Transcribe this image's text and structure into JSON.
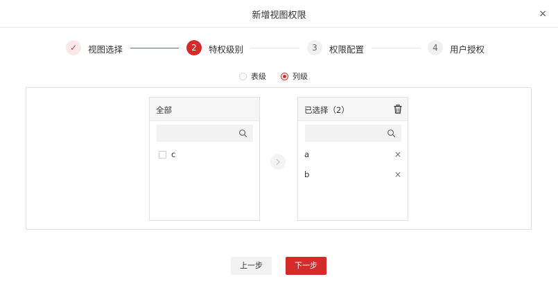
{
  "dialog": {
    "title": "新增视图权限",
    "close_glyph": "×"
  },
  "steps": [
    {
      "number": "✓",
      "label": "视图选择",
      "status": "done"
    },
    {
      "number": "2",
      "label": "特权级别",
      "status": "active"
    },
    {
      "number": "3",
      "label": "权限配置",
      "status": "pending"
    },
    {
      "number": "4",
      "label": "用户授权",
      "status": "pending"
    }
  ],
  "level_options": [
    {
      "label": "表级",
      "selected": false
    },
    {
      "label": "列级",
      "selected": true
    }
  ],
  "left_panel": {
    "title": "全部",
    "search_placeholder": "",
    "items": [
      {
        "label": "c",
        "checked": false
      }
    ]
  },
  "right_panel": {
    "title": "已选择（2）",
    "search_placeholder": "",
    "items": [
      {
        "label": "a",
        "remove_glyph": "×"
      },
      {
        "label": "b",
        "remove_glyph": "×"
      }
    ]
  },
  "buttons": {
    "prev": "上一步",
    "next": "下一步"
  },
  "colors": {
    "accent": "#d52b2b",
    "accent_light": "#fbe9e9",
    "border": "#e1e1e1"
  }
}
